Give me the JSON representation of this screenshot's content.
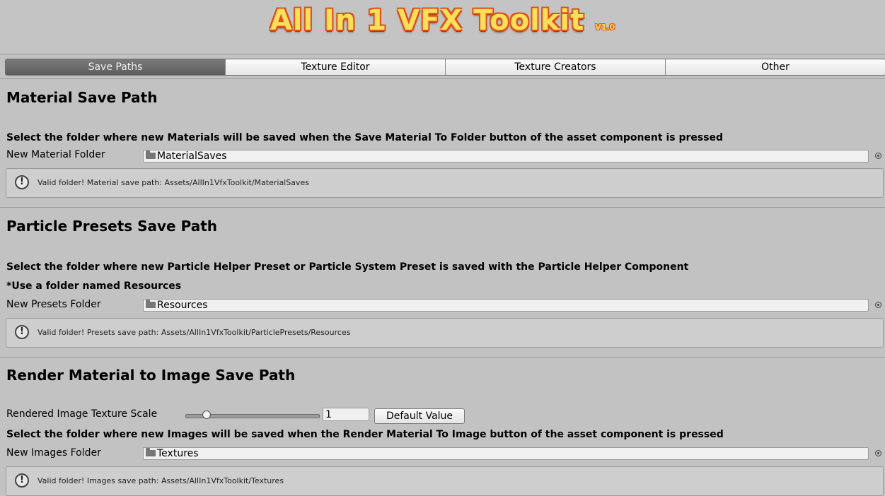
{
  "banner": {
    "title": "All In 1 VFX Toolkit",
    "version": "V1.0"
  },
  "tabs": [
    {
      "label": "Save Paths",
      "active": true
    },
    {
      "label": "Texture Editor"
    },
    {
      "label": "Texture Creators"
    },
    {
      "label": "Other"
    }
  ],
  "material": {
    "heading": "Material Save Path",
    "description": "Select the folder where new Materials will be saved when the Save Material To Folder button of the asset component is pressed",
    "field_label": "New Material Folder",
    "field_value": "MaterialSaves",
    "help": "Valid folder! Material save path: Assets/AllIn1VfxToolkit/MaterialSaves"
  },
  "presets": {
    "heading": "Particle Presets Save Path",
    "description": "Select the folder where new Particle Helper Preset or Particle System Preset is saved with the Particle Helper Component",
    "note": "*Use a folder named Resources",
    "field_label": "New Presets Folder",
    "field_value": "Resources",
    "help": "Valid folder! Presets save path: Assets/AllIn1VfxToolkit/ParticlePresets/Resources"
  },
  "render": {
    "heading": "Render Material to Image Save Path",
    "scale_label": "Rendered Image Texture Scale",
    "scale_value": "1",
    "default_button": "Default Value",
    "description": "Select the folder where new Images will be saved when the Render Material To Image button of the asset component is pressed",
    "field_label": "New Images Folder",
    "field_value": "Textures",
    "help": "Valid folder! Images save path: Assets/AllIn1VfxToolkit/Textures"
  },
  "icons": {
    "folder": "folder-icon",
    "picker": "object-picker-icon",
    "info": "info-icon"
  },
  "colors": {
    "title_fill": "#ffdf5a",
    "title_outline": "#d9531b",
    "active_tab": "#6a6a6a",
    "background": "#c2c2c2"
  }
}
